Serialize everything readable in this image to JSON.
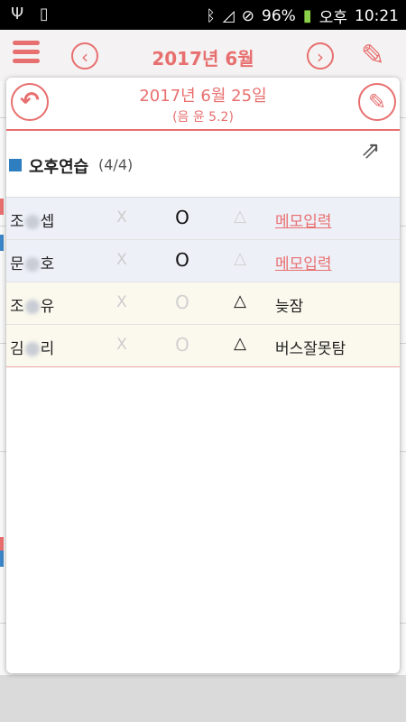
{
  "status_bar": {
    "battery": "96%",
    "ampm": "오후",
    "time": "10:21"
  },
  "app_bar": {
    "month_title": "2017년 6월"
  },
  "dialog": {
    "date": "2017년 6월 25일",
    "lunar": "(음 윤 5.2)",
    "group": {
      "name": "오후연습",
      "count": "(4/4)",
      "color": "#2f7fc0"
    },
    "rows": [
      {
        "name_first": "조",
        "name_last": "셉",
        "x": "X",
        "o": "O",
        "t": "△",
        "memo": "메모입력"
      },
      {
        "name_first": "문",
        "name_last": "호",
        "x": "X",
        "o": "O",
        "t": "△",
        "memo": "메모입력"
      },
      {
        "name_first": "조",
        "name_last": "유",
        "x": "X",
        "o": "O",
        "t": "△",
        "memo": "늦잠"
      },
      {
        "name_first": "김",
        "name_last": "리",
        "x": "X",
        "o": "O",
        "t": "△",
        "memo": "버스잘못탐"
      }
    ]
  },
  "colors": {
    "accent": "#e86f6f",
    "blue": "#2f7fc0"
  },
  "icons": {
    "status": [
      "usb-icon",
      "download-icon",
      "bluetooth-icon",
      "mute-icon",
      "no-sign-icon",
      "battery-icon"
    ],
    "app_bar": [
      "menu-icon",
      "chevron-left-icon",
      "chevron-right-icon",
      "pencil-icon"
    ],
    "dialog": [
      "undo-icon",
      "edit-icon",
      "share-icon"
    ]
  }
}
